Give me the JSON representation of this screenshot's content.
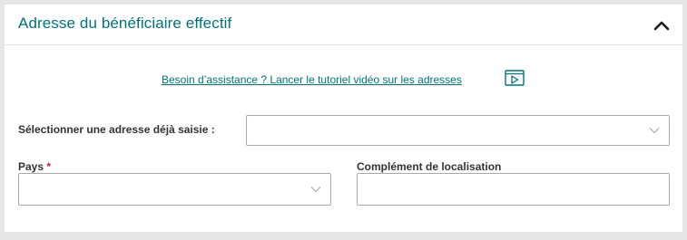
{
  "panel": {
    "title": "Adresse du bénéficiaire effectif"
  },
  "help": {
    "link_text": "Besoin d’assistance ? Lancer le tutoriel vidéo sur les adresses"
  },
  "form": {
    "saved_address": {
      "label": "Sélectionner une adresse déjà saisie :",
      "value": ""
    },
    "country": {
      "label": "Pays",
      "required_marker": "*",
      "value": ""
    },
    "location_complement": {
      "label": "Complément de localisation",
      "value": ""
    }
  },
  "colors": {
    "accent": "#00727a",
    "required": "#c81e3c",
    "border": "#a9a9a9",
    "background": "#e6e6e6"
  },
  "icons": {
    "collapse": "chevron-up-icon",
    "video": "video-play-icon",
    "dropdown": "chevron-down-icon"
  }
}
